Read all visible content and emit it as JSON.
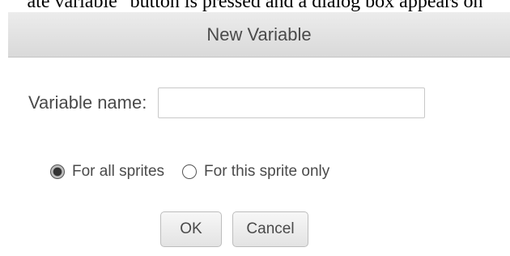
{
  "background_caption": "ate variable\" button is pressed and a dialog box appears on",
  "dialog": {
    "title": "New Variable",
    "name_label": "Variable name:",
    "name_value": "",
    "scope_options": [
      {
        "label": "For all sprites",
        "selected": true
      },
      {
        "label": "For this sprite only",
        "selected": false
      }
    ],
    "ok_label": "OK",
    "cancel_label": "Cancel"
  },
  "colors": {
    "titlebar": "#dedede",
    "text": "#4a4a4a",
    "button_bg": "#efefef",
    "border": "#c8c8c8"
  }
}
